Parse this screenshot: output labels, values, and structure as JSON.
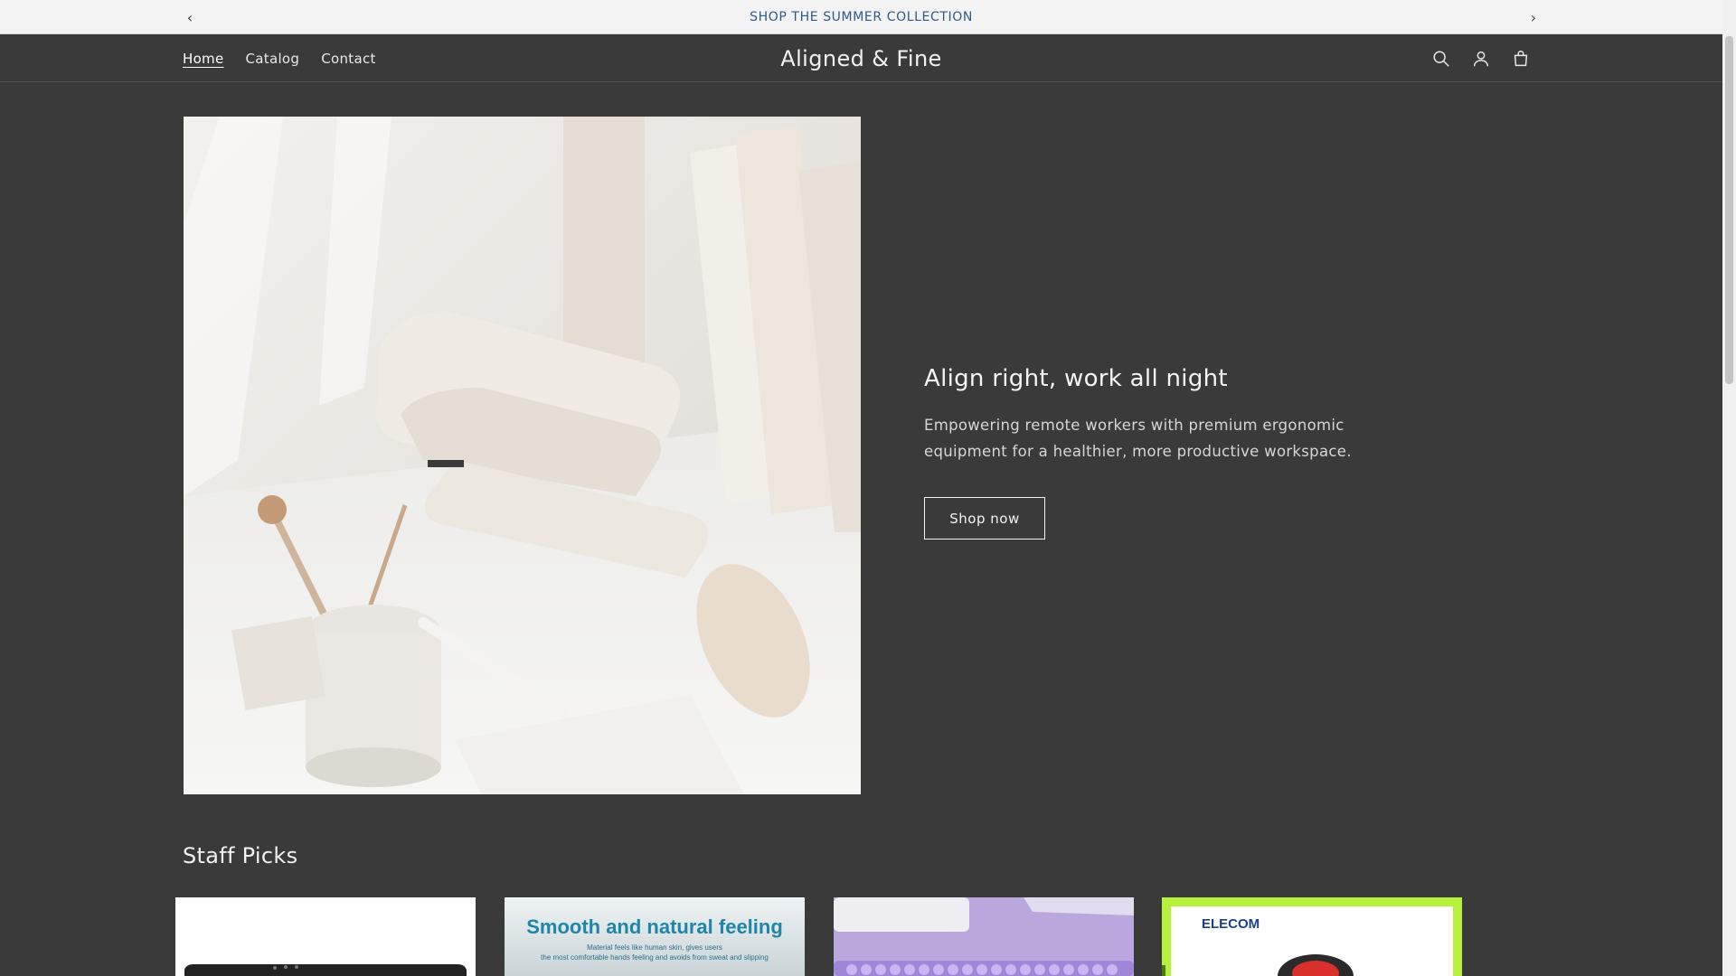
{
  "announcement": {
    "text": "SHOP THE SUMMER COLLECTION"
  },
  "header": {
    "brand": "Aligned & Fine",
    "nav": [
      {
        "label": "Home",
        "active": true
      },
      {
        "label": "Catalog",
        "active": false
      },
      {
        "label": "Contact",
        "active": false
      }
    ],
    "icons": [
      "search-icon",
      "account-icon",
      "cart-icon"
    ]
  },
  "hero": {
    "title": "Align right, work all night",
    "body": "Empowering remote workers with premium ergonomic equipment for a healthier, more productive workspace.",
    "button": "Shop now"
  },
  "staff_picks": {
    "title": "Staff Picks",
    "cards": [
      {
        "name": "product-card-1",
        "banner": ""
      },
      {
        "name": "product-card-2",
        "banner": "Smooth and natural feeling",
        "sub1": "Material feels like human skin, gives users",
        "sub2": "the most comfortable hands feeling and avoids from sweat and slipping"
      },
      {
        "name": "product-card-3",
        "banner": ""
      },
      {
        "name": "product-card-4",
        "banner": "ELECOM"
      }
    ]
  },
  "colors": {
    "page_bg": "#3a3a3a",
    "announce_bg": "#f3f3f3",
    "announce_text": "#2f5a86"
  }
}
